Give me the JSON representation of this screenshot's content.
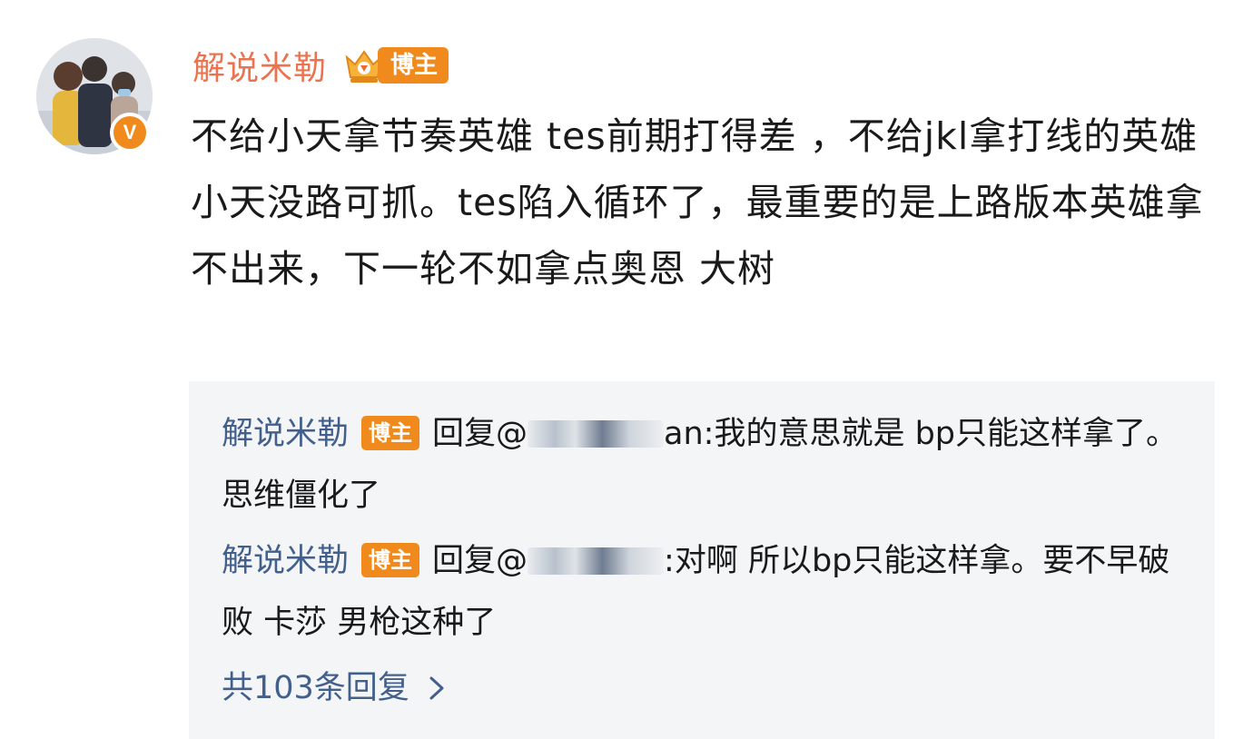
{
  "post": {
    "author": "解说米勒",
    "badge": "博主",
    "verified_mark": "V",
    "content": "不给小天拿节奏英雄 tes前期打得差 ，不给jkl拿打线的英雄 小天没路可抓。tes陷入循环了，最重要的是上路版本英雄拿不出来，下一轮不如拿点奥恩 大树"
  },
  "replies": [
    {
      "author": "解说米勒",
      "badge": "博主",
      "reply_prefix": "回复@",
      "target_visible_start": "",
      "target_visible_end": "an",
      "text": ":我的意思就是 bp只能这样拿了。思维僵化了"
    },
    {
      "author": "解说米勒",
      "badge": "博主",
      "reply_prefix": "回复@",
      "target_visible_start": "",
      "target_visible_end": "",
      "text": ":对啊 所以bp只能这样拿。要不早破败 卡莎 男枪这种了"
    }
  ],
  "more_replies": "共103条回复",
  "colors": {
    "author_orange": "#eb7350",
    "badge_orange": "#f08a1c",
    "reply_name_blue": "#43608c",
    "panel_bg": "#f4f5f7"
  },
  "icons": {
    "verified": "verified-v-icon",
    "crown": "crown-icon",
    "chevron": "chevron-right-icon"
  }
}
